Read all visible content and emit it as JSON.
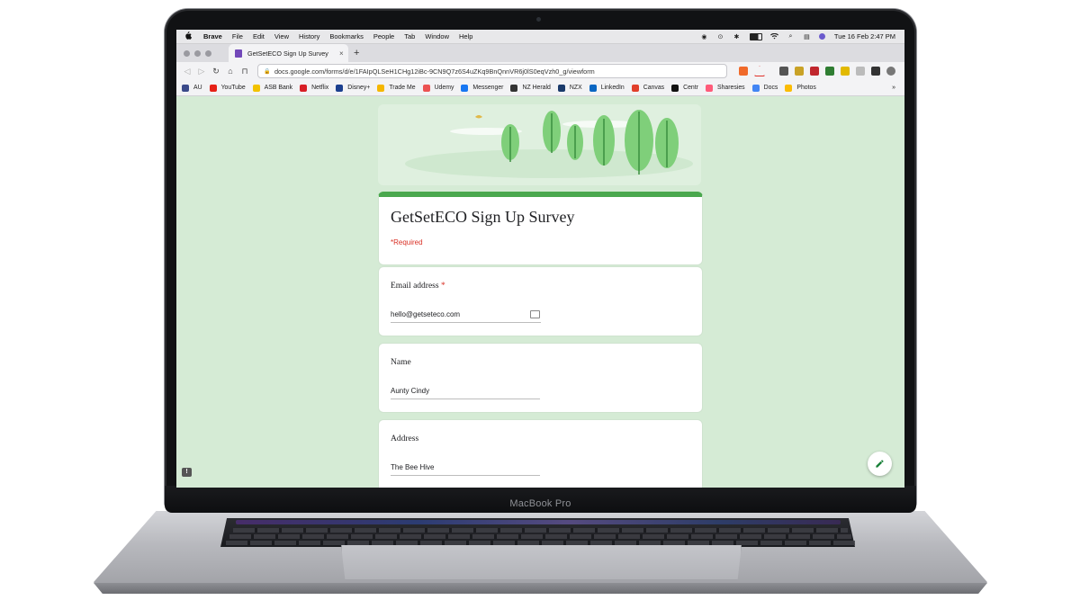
{
  "device": {
    "label": "MacBook Pro"
  },
  "menubar": {
    "app": "Brave",
    "items": [
      "File",
      "Edit",
      "View",
      "History",
      "Bookmarks",
      "People",
      "Tab",
      "Window",
      "Help"
    ],
    "clock": "Tue 16 Feb  2:47 PM"
  },
  "tab": {
    "title": "GetSetECO Sign Up Survey",
    "new_tab_symbol": "+",
    "close_symbol": "×"
  },
  "toolbar": {
    "url": "docs.google.com/forms/d/e/1FAIpQLSeH1CHg12iBc-9CN9Q7z6S4uZKq9BnQnnVR6j0lS0eqVzh0_g/viewform"
  },
  "bookmarks": [
    {
      "label": "AU",
      "color": "#3b4a8a"
    },
    {
      "label": "YouTube",
      "color": "#e62117"
    },
    {
      "label": "ASB Bank",
      "color": "#f2c200"
    },
    {
      "label": "Netflix",
      "color": "#d81f26"
    },
    {
      "label": "Disney+",
      "color": "#1b3f8f"
    },
    {
      "label": "Trade Me",
      "color": "#f5b700"
    },
    {
      "label": "Udemy",
      "color": "#ec5252"
    },
    {
      "label": "Messenger",
      "color": "#1877f2"
    },
    {
      "label": "NZ Herald",
      "color": "#333333"
    },
    {
      "label": "NZX",
      "color": "#1a3a6b"
    },
    {
      "label": "LinkedIn",
      "color": "#0a66c2"
    },
    {
      "label": "Canvas",
      "color": "#e13f2b"
    },
    {
      "label": "Centr",
      "color": "#111111"
    },
    {
      "label": "Sharesies",
      "color": "#ff5b7a"
    },
    {
      "label": "Docs",
      "color": "#4285f4"
    },
    {
      "label": "Photos",
      "color": "#fbbc04"
    }
  ],
  "bookmarks_overflow": "»",
  "form": {
    "title": "GetSetECO Sign Up Survey",
    "required_note": "*Required",
    "questions": [
      {
        "label": "Email address",
        "required_mark": "*",
        "answer": "hello@getseteco.com"
      },
      {
        "label": "Name",
        "answer": "Aunty Cindy"
      },
      {
        "label": "Address",
        "answer": "The Bee Hive"
      }
    ]
  },
  "colors": {
    "page_bg": "#d5ebd5",
    "accent": "#4aa84e",
    "required": "#d93025"
  }
}
